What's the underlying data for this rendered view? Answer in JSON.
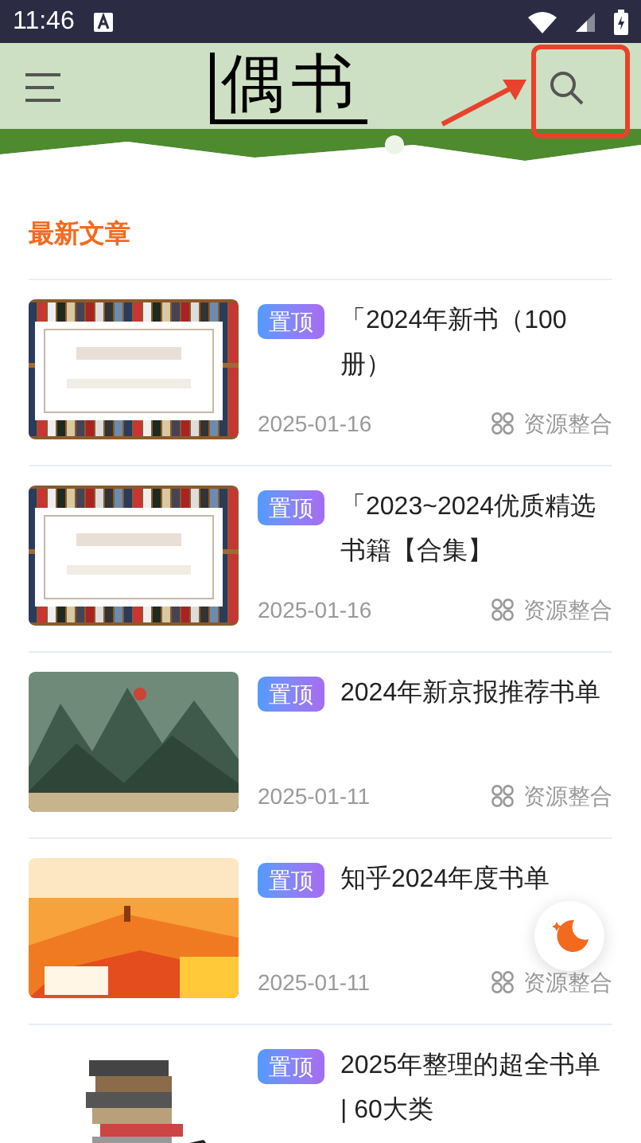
{
  "status_bar": {
    "time": "11:46"
  },
  "app_bar": {
    "logo": "偶书"
  },
  "section_title": "最新文章",
  "articles": [
    {
      "pinned": true,
      "badge": "置顶",
      "title": "「2024年新书（100册）",
      "date": "2025-01-16",
      "source": "资源整合"
    },
    {
      "pinned": true,
      "badge": "置顶",
      "title": "「2023~2024优质精选书籍【合集】",
      "date": "2025-01-16",
      "source": "资源整合"
    },
    {
      "pinned": true,
      "badge": "置顶",
      "title": "2024年新京报推荐书单",
      "date": "2025-01-11",
      "source": "资源整合"
    },
    {
      "pinned": true,
      "badge": "置顶",
      "title": "知乎2024年度书单",
      "date": "2025-01-11",
      "source": "资源整合"
    },
    {
      "pinned": true,
      "badge": "置顶",
      "title": "2025年整理的超全书单 | 60大类"
    }
  ]
}
